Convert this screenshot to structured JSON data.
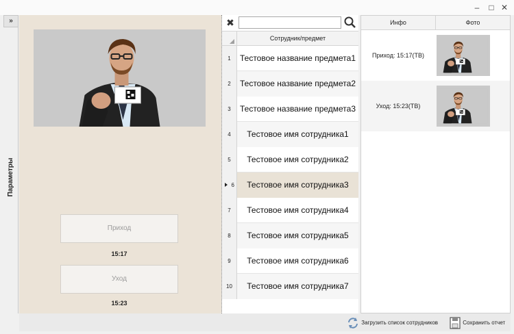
{
  "window": {
    "minimize": "–",
    "maximize": "□",
    "close": "✕"
  },
  "sidebar": {
    "expand_label": "»",
    "params_label": "Параметры"
  },
  "left": {
    "arrival_button": "Приход",
    "arrival_time": "15:17",
    "departure_button": "Уход",
    "departure_time": "15:23"
  },
  "search": {
    "value": "",
    "clear_label": "✖"
  },
  "grid": {
    "column_header": "Сотрудник/предмет",
    "selected_index": 6,
    "rows": [
      {
        "num": "1",
        "text": "Тестовое название предмета1"
      },
      {
        "num": "2",
        "text": "Тестовое название предмета2"
      },
      {
        "num": "3",
        "text": "Тестовое название предмета3"
      },
      {
        "num": "4",
        "text": "Тестовое имя сотрудника1"
      },
      {
        "num": "5",
        "text": "Тестовое имя сотрудника2"
      },
      {
        "num": "6",
        "text": "Тестовое имя сотрудника3"
      },
      {
        "num": "7",
        "text": "Тестовое имя сотрудника4"
      },
      {
        "num": "8",
        "text": "Тестовое имя сотрудника5"
      },
      {
        "num": "9",
        "text": "Тестовое имя сотрудника6"
      },
      {
        "num": "10",
        "text": "Тестовое имя сотрудника7"
      }
    ]
  },
  "right": {
    "col_info": "Инфо",
    "col_photo": "Фото",
    "rows": [
      {
        "info": "Приход: 15:17(ТВ)"
      },
      {
        "info": "Уход: 15:23(ТВ)"
      }
    ]
  },
  "footer": {
    "load_label": "Загрузить список сотрудников",
    "save_label": "Сохранить отчет"
  }
}
